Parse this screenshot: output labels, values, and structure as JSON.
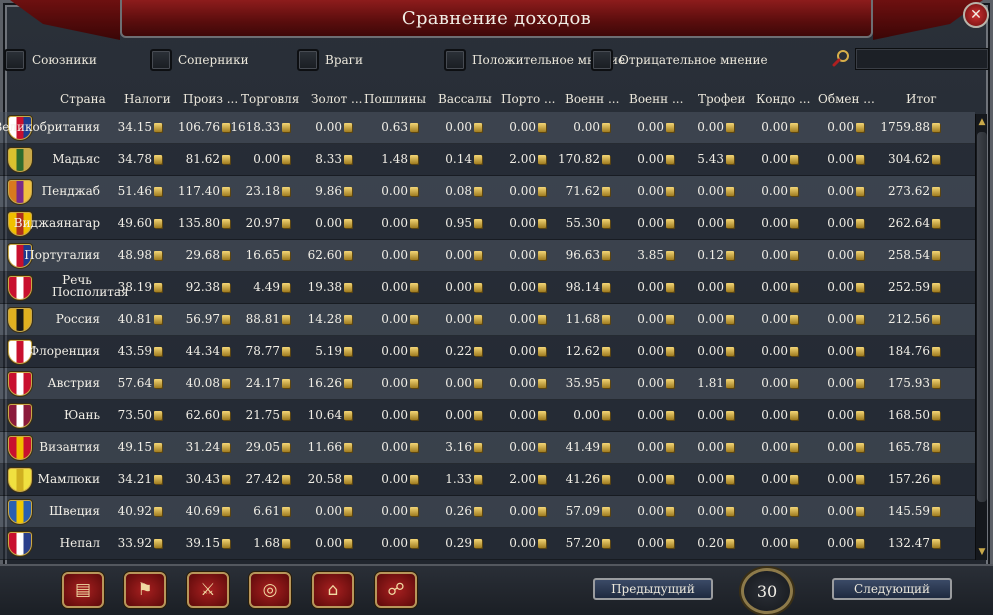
{
  "window": {
    "title": "Сравнение доходов",
    "close_glyph": "✕"
  },
  "filters": [
    {
      "label": "Союзники",
      "checked": false
    },
    {
      "label": "Соперники",
      "checked": false
    },
    {
      "label": "Враги",
      "checked": false
    },
    {
      "label": "Положительное мнение",
      "checked": false
    },
    {
      "label": "Отрицательное мнение",
      "checked": false
    }
  ],
  "search": {
    "value": "",
    "placeholder": ""
  },
  "columns": [
    "Страна",
    "Налоги",
    "Произ ...",
    "Торговля",
    "Золот ...",
    "Пошлины",
    "Вассалы",
    "Порто ...",
    "Военн ...",
    "Военн ...",
    "Трофеи",
    "Кондо ...",
    "Обмен ...",
    "Итог"
  ],
  "rows": [
    {
      "country": "Великобритания",
      "flag": [
        "#ffffff",
        "#c8102e",
        "#1d3c8f"
      ],
      "values": [
        "34.15",
        "106.76",
        "1618.33",
        "0.00",
        "0.63",
        "0.00",
        "0.00",
        "0.00",
        "0.00",
        "0.00",
        "0.00",
        "0.00",
        "1759.88"
      ]
    },
    {
      "country": "Мадьяс",
      "flag": [
        "#d9c22e",
        "#2e6b2e",
        "#c9a94a"
      ],
      "values": [
        "34.78",
        "81.62",
        "0.00",
        "8.33",
        "1.48",
        "0.14",
        "2.00",
        "170.82",
        "0.00",
        "5.43",
        "0.00",
        "0.00",
        "304.62"
      ]
    },
    {
      "country": "Пенджаб",
      "flag": [
        "#d87a1e",
        "#7a2a8a",
        "#f0c040"
      ],
      "values": [
        "51.46",
        "117.40",
        "23.18",
        "9.86",
        "0.00",
        "0.08",
        "0.00",
        "71.62",
        "0.00",
        "0.00",
        "0.00",
        "0.00",
        "273.62"
      ]
    },
    {
      "country": "Виджаянагар",
      "flag": [
        "#f0c000",
        "#b0301e",
        "#f0c000"
      ],
      "values": [
        "49.60",
        "135.80",
        "20.97",
        "0.00",
        "0.00",
        "0.95",
        "0.00",
        "55.30",
        "0.00",
        "0.00",
        "0.00",
        "0.00",
        "262.64"
      ]
    },
    {
      "country": "Португалия",
      "flag": [
        "#ffffff",
        "#c8102e",
        "#1d3c8f"
      ],
      "values": [
        "48.98",
        "29.68",
        "16.65",
        "62.60",
        "0.00",
        "0.00",
        "0.00",
        "96.63",
        "3.85",
        "0.12",
        "0.00",
        "0.00",
        "258.54"
      ]
    },
    {
      "country": "Речь Посполитая",
      "flag": [
        "#c8102e",
        "#ffffff",
        "#c8102e"
      ],
      "values": [
        "38.19",
        "92.38",
        "4.49",
        "19.38",
        "0.00",
        "0.00",
        "0.00",
        "98.14",
        "0.00",
        "0.00",
        "0.00",
        "0.00",
        "252.59"
      ]
    },
    {
      "country": "Россия",
      "flag": [
        "#e0b020",
        "#1a1a1a",
        "#e0b020"
      ],
      "values": [
        "40.81",
        "56.97",
        "88.81",
        "14.28",
        "0.00",
        "0.00",
        "0.00",
        "11.68",
        "0.00",
        "0.00",
        "0.00",
        "0.00",
        "212.56"
      ]
    },
    {
      "country": "Флоренция",
      "flag": [
        "#ffffff",
        "#c8102e",
        "#ffffff"
      ],
      "values": [
        "43.59",
        "44.34",
        "78.77",
        "5.19",
        "0.00",
        "0.22",
        "0.00",
        "12.62",
        "0.00",
        "0.00",
        "0.00",
        "0.00",
        "184.76"
      ]
    },
    {
      "country": "Австрия",
      "flag": [
        "#c8102e",
        "#ffffff",
        "#c8102e"
      ],
      "values": [
        "57.64",
        "40.08",
        "24.17",
        "16.26",
        "0.00",
        "0.00",
        "0.00",
        "35.95",
        "0.00",
        "1.81",
        "0.00",
        "0.00",
        "175.93"
      ]
    },
    {
      "country": "Юань",
      "flag": [
        "#8a1a3a",
        "#ffffff",
        "#8a1a3a"
      ],
      "values": [
        "73.50",
        "62.60",
        "21.75",
        "10.64",
        "0.00",
        "0.00",
        "0.00",
        "0.00",
        "0.00",
        "0.00",
        "0.00",
        "0.00",
        "168.50"
      ]
    },
    {
      "country": "Византия",
      "flag": [
        "#c8102e",
        "#f0c000",
        "#c8102e"
      ],
      "values": [
        "49.15",
        "31.24",
        "29.05",
        "11.66",
        "0.00",
        "3.16",
        "0.00",
        "41.49",
        "0.00",
        "0.00",
        "0.00",
        "0.00",
        "165.78"
      ]
    },
    {
      "country": "Мамлюки",
      "flag": [
        "#f0e040",
        "#d0b020",
        "#f0e040"
      ],
      "values": [
        "34.21",
        "30.43",
        "27.42",
        "20.58",
        "0.00",
        "1.33",
        "2.00",
        "41.26",
        "0.00",
        "0.00",
        "0.00",
        "0.00",
        "157.26"
      ]
    },
    {
      "country": "Швеция",
      "flag": [
        "#2a5fb0",
        "#f0c800",
        "#2a5fb0"
      ],
      "values": [
        "40.92",
        "40.69",
        "6.61",
        "0.00",
        "0.00",
        "0.26",
        "0.00",
        "57.09",
        "0.00",
        "0.00",
        "0.00",
        "0.00",
        "145.59"
      ]
    },
    {
      "country": "Непал",
      "flag": [
        "#c8102e",
        "#ffffff",
        "#2a3f8a"
      ],
      "values": [
        "33.92",
        "39.15",
        "1.68",
        "0.00",
        "0.00",
        "0.29",
        "0.00",
        "57.20",
        "0.00",
        "0.20",
        "0.00",
        "0.00",
        "132.47"
      ]
    }
  ],
  "bottom_tabs": [
    {
      "icon": "ledger-icon",
      "glyph": "▤"
    },
    {
      "icon": "flag-icon",
      "glyph": "⚑"
    },
    {
      "icon": "crossed-swords-icon",
      "glyph": "⚔"
    },
    {
      "icon": "coins-icon",
      "glyph": "◎"
    },
    {
      "icon": "buildings-icon",
      "glyph": "⌂"
    },
    {
      "icon": "handshake-icon",
      "glyph": "☍"
    }
  ],
  "pagination": {
    "prev_label": "Предыдущий",
    "page": "30",
    "next_label": "Следующий"
  },
  "colors": {
    "title_red": "#8d1c1c",
    "row_light": "#4c5663",
    "row_dark": "#262d37",
    "gold": "#c9a94a"
  }
}
